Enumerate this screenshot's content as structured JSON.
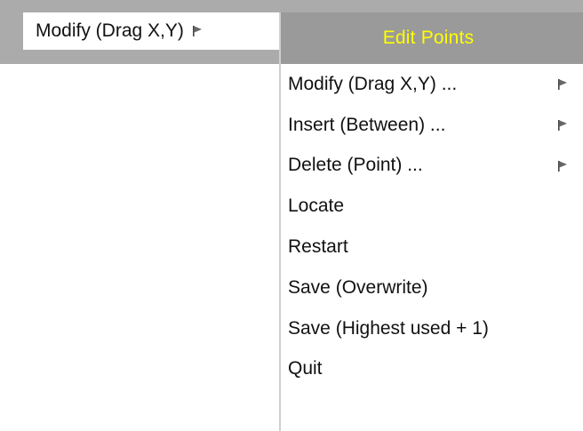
{
  "parent_menu": {
    "item_label": "Modify (Drag X,Y)",
    "item_icon": "submenu-flag-icon"
  },
  "submenu": {
    "title": "Edit Points",
    "title_color": "#ffff00",
    "header_color": "#9a9a9a",
    "items": [
      {
        "label": "Modify (Drag X,Y) ...",
        "has_submenu": true,
        "icon": "submenu-flag-icon"
      },
      {
        "label": "Insert (Between) ...",
        "has_submenu": true,
        "icon": "submenu-flag-icon"
      },
      {
        "label": "Delete (Point) ...",
        "has_submenu": true,
        "icon": "submenu-flag-icon"
      },
      {
        "label": "Locate",
        "has_submenu": false
      },
      {
        "label": "Restart",
        "has_submenu": false
      },
      {
        "label": "Save (Overwrite)",
        "has_submenu": false
      },
      {
        "label": "Save (Highest used + 1)",
        "has_submenu": false
      },
      {
        "label": "Quit",
        "has_submenu": false
      }
    ]
  }
}
